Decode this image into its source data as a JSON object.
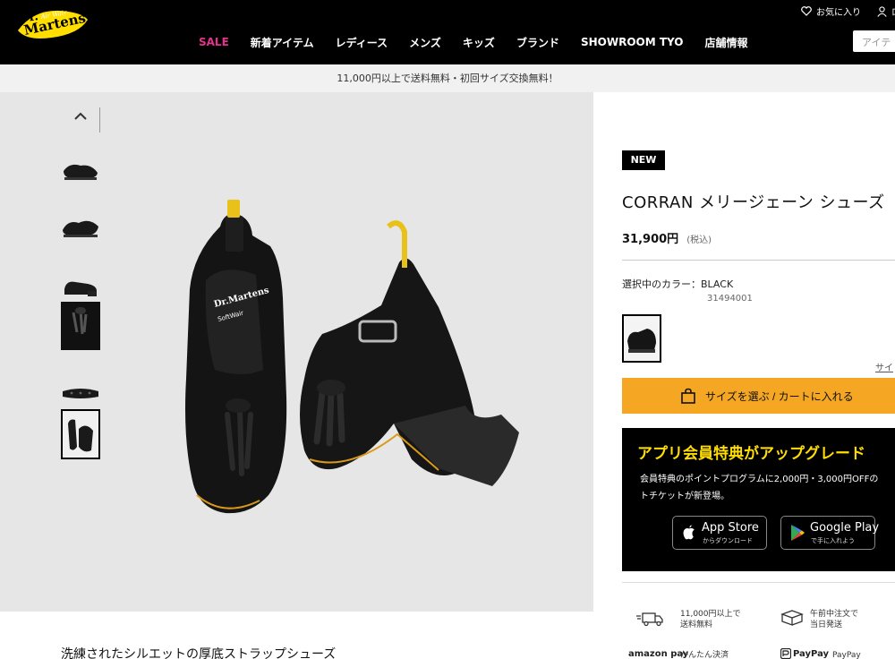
{
  "header": {
    "brand_colors": {
      "background": "#000000",
      "logo_yellow": "#ffde00",
      "sale": "#e6328c"
    },
    "nav": [
      {
        "label": "SALE"
      },
      {
        "label": "新着アイテム"
      },
      {
        "label": "レディース"
      },
      {
        "label": "メンズ"
      },
      {
        "label": "キッズ"
      },
      {
        "label": "ブランド"
      },
      {
        "label": "SHOWROOM TYO"
      },
      {
        "label": "店舗情報"
      }
    ],
    "favorites_label": "お気に入り",
    "account_label": "ロ",
    "search_placeholder": "アイテ"
  },
  "banner": {
    "text": "11,000円以上で送料無料・初回サイズ交換無料！"
  },
  "gallery": {
    "thumbnails": [
      "thumb-1",
      "thumb-2",
      "thumb-3",
      "thumb-4",
      "thumb-5",
      "thumb-6"
    ],
    "active_thumbnail": 6
  },
  "product": {
    "badge": "NEW",
    "title": "CORRAN メリージェーン シューズ",
    "price": "31,900円",
    "tax_note": "(税込)",
    "color_label": "選択中のカラー：BLACK",
    "sku": "31494001",
    "size_guide": "サイ",
    "tagline": "洗練されたシルエットの厚底ストラップシューズ"
  },
  "cart": {
    "label": "サイズを選ぶ / カートに入れる",
    "accent": "#f5a623"
  },
  "app_promo": {
    "headline": "アプリ会員特典がアップグレード",
    "body_line1": "会員特典のポイントプログラムに2,000円・3,000円OFFの",
    "body_line2": "トチケットが新登場。",
    "app_store_big": "App Store",
    "app_store_small": "からダウンロード",
    "google_play_big": "Google Play",
    "google_play_small": "で手に入れよう"
  },
  "benefits": [
    {
      "line1": "11,000円以上で",
      "line2": "送料無料",
      "icon": "truck-icon"
    },
    {
      "line1": "午前中注文で",
      "line2": "当日発送",
      "icon": "box-icon"
    },
    {
      "line1": "かんたん決済",
      "line2": "",
      "icon": "amazon-pay-logo",
      "logo_text": "amazon pay"
    },
    {
      "line1": "PayPay",
      "line2": "",
      "icon": "paypay-logo",
      "logo_text": "PayPay"
    }
  ]
}
